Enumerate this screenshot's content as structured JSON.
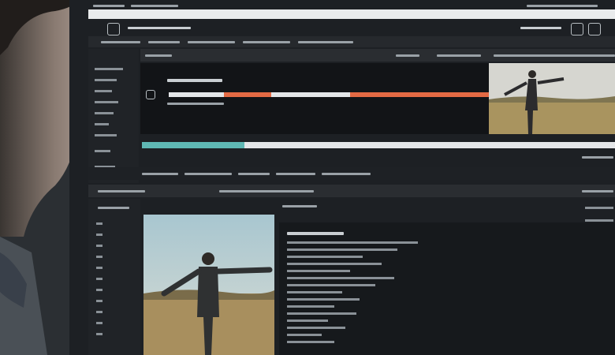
{
  "colors": {
    "accent_orange": "#e46a44",
    "accent_teal": "#5fb8b4",
    "bg": "#1d2024",
    "panel": "#14171a",
    "track": "#e4e6e8"
  },
  "icons": [
    "monitor-icon",
    "menu-icon",
    "play-icon",
    "settings-icon"
  ],
  "progress": {
    "timeline_played": 0.42,
    "scrub_teal": 0.3
  }
}
